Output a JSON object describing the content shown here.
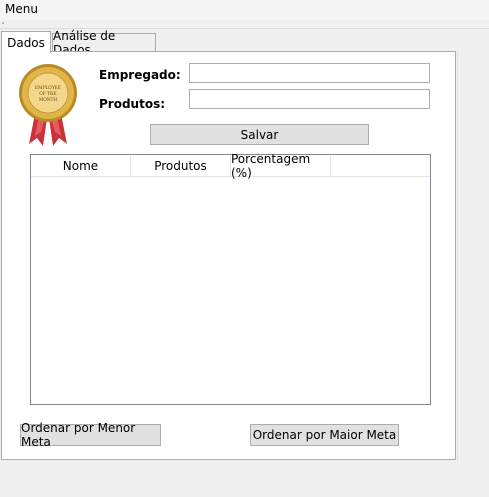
{
  "menu": {
    "label": "Menu"
  },
  "tabs": [
    {
      "label": "Dados",
      "active": true
    },
    {
      "label": "Análise de Dados",
      "active": false
    }
  ],
  "form": {
    "employee_label": "Empregado:",
    "employee_value": "",
    "products_label": "Produtos:",
    "products_value": "",
    "save_label": "Salvar"
  },
  "table": {
    "columns": [
      "Nome",
      "Produtos",
      "Porcentagem (%)"
    ],
    "rows": []
  },
  "footer": {
    "sort_asc_label": "Ordenar por Menor Meta",
    "sort_desc_label": "Ordenar por Maior Meta"
  },
  "badge": {
    "text_line1": "EMPLOYEE",
    "text_line2": "OF THE",
    "text_line3": "MONTH",
    "icon": "medal-icon",
    "gold": "#d9a93a",
    "ribbon": "#c8323a"
  }
}
